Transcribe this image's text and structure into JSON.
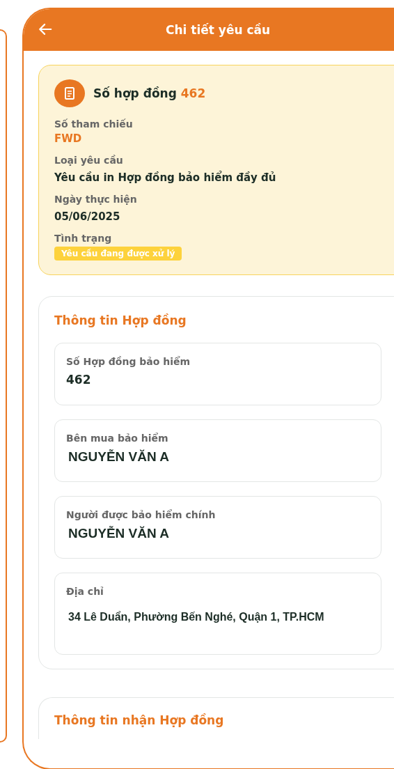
{
  "header": {
    "title": "Chi tiết yêu cầu"
  },
  "summary": {
    "title": "Số hợp đồng",
    "number": "462",
    "fields": [
      {
        "label": "Số tham chiếu",
        "value": "FWD",
        "kind": "accent"
      },
      {
        "label": "Loại yêu cầu",
        "value": "Yêu cầu in Hợp đồng bảo hiểm đầy đủ",
        "kind": "text"
      },
      {
        "label": "Ngày thực hiện",
        "value": "05/06/2025",
        "kind": "text"
      },
      {
        "label": "Tình trạng",
        "value": "Yêu cầu đang được xử lý",
        "kind": "badge"
      }
    ]
  },
  "contract_info": {
    "title": "Thông tin Hợp đồng",
    "fields": [
      {
        "label": "Số Hợp đồng bảo hiểm",
        "value": "462"
      },
      {
        "label": "Bên mua bảo hiểm",
        "value": "NGUYỄN VĂN A"
      },
      {
        "label": "Người được bảo hiểm chính",
        "value": "NGUYỄN VĂN A"
      },
      {
        "label": "Địa chỉ",
        "value": "34 Lê Duẩn, Phường Bến Nghé, Quận 1, TP.HCM"
      }
    ]
  },
  "delivery_info": {
    "title": "Thông tin nhận Hợp đồng"
  }
}
